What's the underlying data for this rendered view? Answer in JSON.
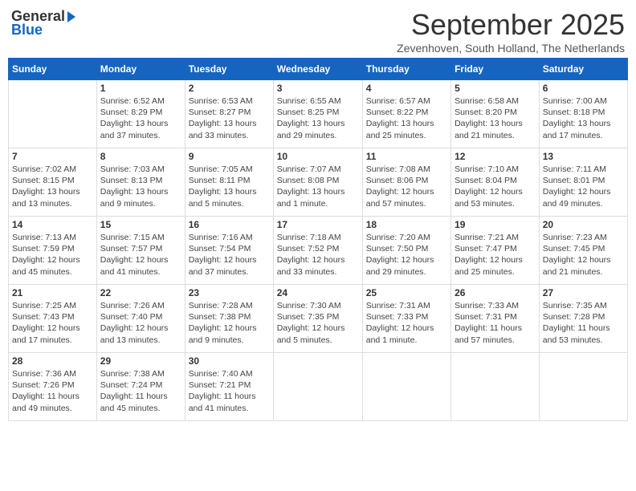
{
  "logo": {
    "general": "General",
    "blue": "Blue"
  },
  "title": "September 2025",
  "location": "Zevenhoven, South Holland, The Netherlands",
  "weekdays": [
    "Sunday",
    "Monday",
    "Tuesday",
    "Wednesday",
    "Thursday",
    "Friday",
    "Saturday"
  ],
  "weeks": [
    [
      {
        "day": "",
        "info": ""
      },
      {
        "day": "1",
        "info": "Sunrise: 6:52 AM\nSunset: 8:29 PM\nDaylight: 13 hours\nand 37 minutes."
      },
      {
        "day": "2",
        "info": "Sunrise: 6:53 AM\nSunset: 8:27 PM\nDaylight: 13 hours\nand 33 minutes."
      },
      {
        "day": "3",
        "info": "Sunrise: 6:55 AM\nSunset: 8:25 PM\nDaylight: 13 hours\nand 29 minutes."
      },
      {
        "day": "4",
        "info": "Sunrise: 6:57 AM\nSunset: 8:22 PM\nDaylight: 13 hours\nand 25 minutes."
      },
      {
        "day": "5",
        "info": "Sunrise: 6:58 AM\nSunset: 8:20 PM\nDaylight: 13 hours\nand 21 minutes."
      },
      {
        "day": "6",
        "info": "Sunrise: 7:00 AM\nSunset: 8:18 PM\nDaylight: 13 hours\nand 17 minutes."
      }
    ],
    [
      {
        "day": "7",
        "info": "Sunrise: 7:02 AM\nSunset: 8:15 PM\nDaylight: 13 hours\nand 13 minutes."
      },
      {
        "day": "8",
        "info": "Sunrise: 7:03 AM\nSunset: 8:13 PM\nDaylight: 13 hours\nand 9 minutes."
      },
      {
        "day": "9",
        "info": "Sunrise: 7:05 AM\nSunset: 8:11 PM\nDaylight: 13 hours\nand 5 minutes."
      },
      {
        "day": "10",
        "info": "Sunrise: 7:07 AM\nSunset: 8:08 PM\nDaylight: 13 hours\nand 1 minute."
      },
      {
        "day": "11",
        "info": "Sunrise: 7:08 AM\nSunset: 8:06 PM\nDaylight: 12 hours\nand 57 minutes."
      },
      {
        "day": "12",
        "info": "Sunrise: 7:10 AM\nSunset: 8:04 PM\nDaylight: 12 hours\nand 53 minutes."
      },
      {
        "day": "13",
        "info": "Sunrise: 7:11 AM\nSunset: 8:01 PM\nDaylight: 12 hours\nand 49 minutes."
      }
    ],
    [
      {
        "day": "14",
        "info": "Sunrise: 7:13 AM\nSunset: 7:59 PM\nDaylight: 12 hours\nand 45 minutes."
      },
      {
        "day": "15",
        "info": "Sunrise: 7:15 AM\nSunset: 7:57 PM\nDaylight: 12 hours\nand 41 minutes."
      },
      {
        "day": "16",
        "info": "Sunrise: 7:16 AM\nSunset: 7:54 PM\nDaylight: 12 hours\nand 37 minutes."
      },
      {
        "day": "17",
        "info": "Sunrise: 7:18 AM\nSunset: 7:52 PM\nDaylight: 12 hours\nand 33 minutes."
      },
      {
        "day": "18",
        "info": "Sunrise: 7:20 AM\nSunset: 7:50 PM\nDaylight: 12 hours\nand 29 minutes."
      },
      {
        "day": "19",
        "info": "Sunrise: 7:21 AM\nSunset: 7:47 PM\nDaylight: 12 hours\nand 25 minutes."
      },
      {
        "day": "20",
        "info": "Sunrise: 7:23 AM\nSunset: 7:45 PM\nDaylight: 12 hours\nand 21 minutes."
      }
    ],
    [
      {
        "day": "21",
        "info": "Sunrise: 7:25 AM\nSunset: 7:43 PM\nDaylight: 12 hours\nand 17 minutes."
      },
      {
        "day": "22",
        "info": "Sunrise: 7:26 AM\nSunset: 7:40 PM\nDaylight: 12 hours\nand 13 minutes."
      },
      {
        "day": "23",
        "info": "Sunrise: 7:28 AM\nSunset: 7:38 PM\nDaylight: 12 hours\nand 9 minutes."
      },
      {
        "day": "24",
        "info": "Sunrise: 7:30 AM\nSunset: 7:35 PM\nDaylight: 12 hours\nand 5 minutes."
      },
      {
        "day": "25",
        "info": "Sunrise: 7:31 AM\nSunset: 7:33 PM\nDaylight: 12 hours\nand 1 minute."
      },
      {
        "day": "26",
        "info": "Sunrise: 7:33 AM\nSunset: 7:31 PM\nDaylight: 11 hours\nand 57 minutes."
      },
      {
        "day": "27",
        "info": "Sunrise: 7:35 AM\nSunset: 7:28 PM\nDaylight: 11 hours\nand 53 minutes."
      }
    ],
    [
      {
        "day": "28",
        "info": "Sunrise: 7:36 AM\nSunset: 7:26 PM\nDaylight: 11 hours\nand 49 minutes."
      },
      {
        "day": "29",
        "info": "Sunrise: 7:38 AM\nSunset: 7:24 PM\nDaylight: 11 hours\nand 45 minutes."
      },
      {
        "day": "30",
        "info": "Sunrise: 7:40 AM\nSunset: 7:21 PM\nDaylight: 11 hours\nand 41 minutes."
      },
      {
        "day": "",
        "info": ""
      },
      {
        "day": "",
        "info": ""
      },
      {
        "day": "",
        "info": ""
      },
      {
        "day": "",
        "info": ""
      }
    ]
  ]
}
